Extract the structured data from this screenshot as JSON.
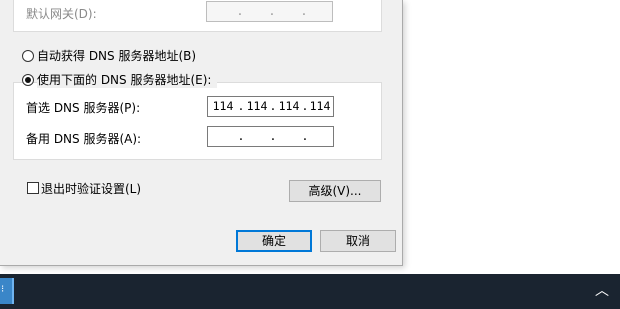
{
  "dialog": {
    "default_gateway": {
      "label": "默认网关(D):",
      "octets": [
        "",
        "",
        "",
        ""
      ]
    },
    "dns_auto_label": "自动获得 DNS 服务器地址(B)",
    "dns_manual_label": "使用下面的 DNS 服务器地址(E):",
    "preferred_dns": {
      "label": "首选 DNS 服务器(P):",
      "octets": [
        "114",
        "114",
        "114",
        "114"
      ]
    },
    "alternate_dns": {
      "label": "备用 DNS 服务器(A):",
      "octets": [
        "",
        "",
        "",
        ""
      ]
    },
    "validate_on_exit_label": "退出时验证设置(L)",
    "advanced_button": "高级(V)...",
    "ok_button": "确定",
    "cancel_button": "取消"
  },
  "taskbar": {
    "app_icon": "network-icon",
    "tray_chevron_icon": "chevron-up-icon"
  },
  "colors": {
    "dialog_bg": "#f0f0f0",
    "taskbar_bg": "#1a2430",
    "default_button_border": "#0078d7"
  }
}
